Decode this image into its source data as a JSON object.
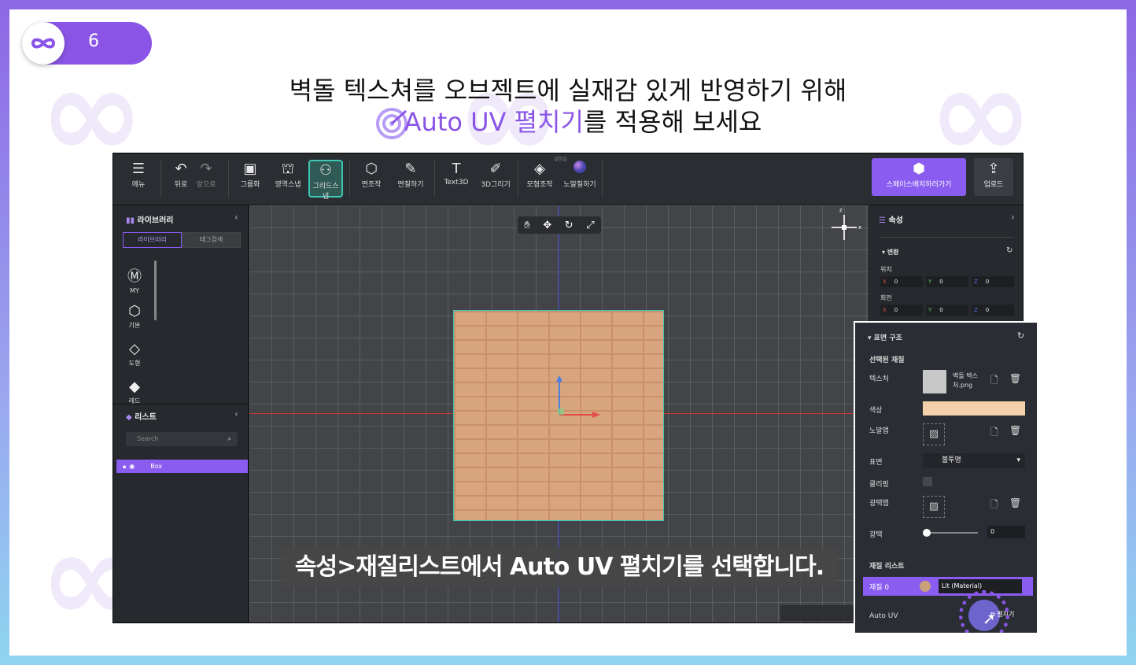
{
  "slide": {
    "number": "6"
  },
  "heading": {
    "line1": "벽돌 텍스쳐를 오브젝트에 실재감 있게 반영하기 위해",
    "line2_highlight": "Auto UV 펼치기",
    "line2_rest": "를 적용해 보세요"
  },
  "colors": {
    "accent": "#8a55e6",
    "teal": "#3fc7b4",
    "brick": "#d9a57e"
  },
  "toolbar": {
    "menu": "메뉴",
    "undo": "뒤로",
    "redo": "앞으로",
    "group": "그룹화",
    "area_snap": "영역스냅",
    "grid_snap": "그리드스냅",
    "face_edit": "면조작",
    "paint": "면칠하기",
    "text3d": "Text3D",
    "draw3d": "3D그리기",
    "model_edit": "모형조작",
    "normal_paint": "노말칠하기",
    "tiny_label": "실험실",
    "space_button": "스페이스배치하러가기",
    "upload": "업로드"
  },
  "library": {
    "title": "라이브러리",
    "tabs": [
      "라이브러리",
      "태그검색"
    ],
    "categories": [
      "MY",
      "기본",
      "도형",
      "레드"
    ]
  },
  "list": {
    "title": "리스트",
    "search_placeholder": "Search",
    "items": [
      "Box"
    ]
  },
  "viewport": {
    "caption": "속성>재질리스트에서 Auto UV 펼치기를 선택합니다.",
    "gizmo_labels": {
      "z": "z",
      "x": "x"
    }
  },
  "properties": {
    "title": "속성",
    "transform": "변환",
    "position": "위치",
    "rotation": "회전",
    "axes": [
      "X",
      "Y",
      "Z"
    ],
    "pos_values": [
      "0",
      "0",
      "0"
    ],
    "rot_values": [
      "0",
      "0",
      "0"
    ]
  },
  "surface": {
    "title": "표면 구조",
    "selected_material": "선택된 재질",
    "texture_label": "텍스처",
    "texture_file": "벽돌 텍스처.png",
    "color_label": "색상",
    "color_value": "#f2d0aa",
    "normal_label": "노말맵",
    "surface_label": "표면",
    "surface_value": "불투명",
    "clipping_label": "클리핑",
    "gloss_map_label": "광택맵",
    "gloss_label": "광택",
    "gloss_value": "0",
    "gloss_fraction": 0.0,
    "material_list": "재질 리스트",
    "material_name": "재질 0",
    "material_type": "Lit (Material)",
    "auto_uv_label": "Auto UV",
    "auto_uv_button": "펼치기"
  }
}
